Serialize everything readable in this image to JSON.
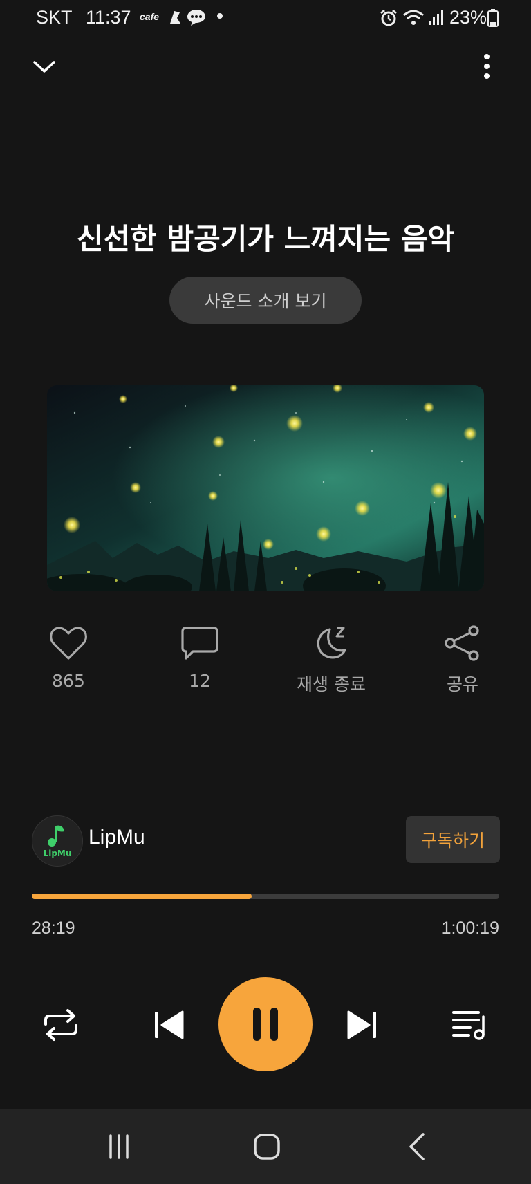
{
  "status_bar": {
    "carrier": "SKT",
    "time": "11:37",
    "cafe": "cafe",
    "battery": "23%"
  },
  "header": {
    "collapse_icon": "chevron-down-icon",
    "menu_icon": "more-vertical-icon"
  },
  "content": {
    "title": "신선한 밤공기가 느껴지는 음악",
    "intro_button": "사운드 소개 보기"
  },
  "actions": [
    {
      "icon": "heart-icon",
      "label": "865"
    },
    {
      "icon": "comment-icon",
      "label": "12"
    },
    {
      "icon": "sleep-timer-icon",
      "label": "재생 종료"
    },
    {
      "icon": "share-icon",
      "label": "공유"
    }
  ],
  "channel": {
    "name": "LipMu",
    "logo_text": "LipMu",
    "subscribe_label": "구독하기"
  },
  "player": {
    "current_time": "28:19",
    "total_time": "1:00:19",
    "progress": 0.47,
    "accent": "#f7a53c"
  },
  "nav": {
    "recent_icon": "recent-apps-icon",
    "home_icon": "home-icon",
    "back_icon": "back-icon"
  }
}
